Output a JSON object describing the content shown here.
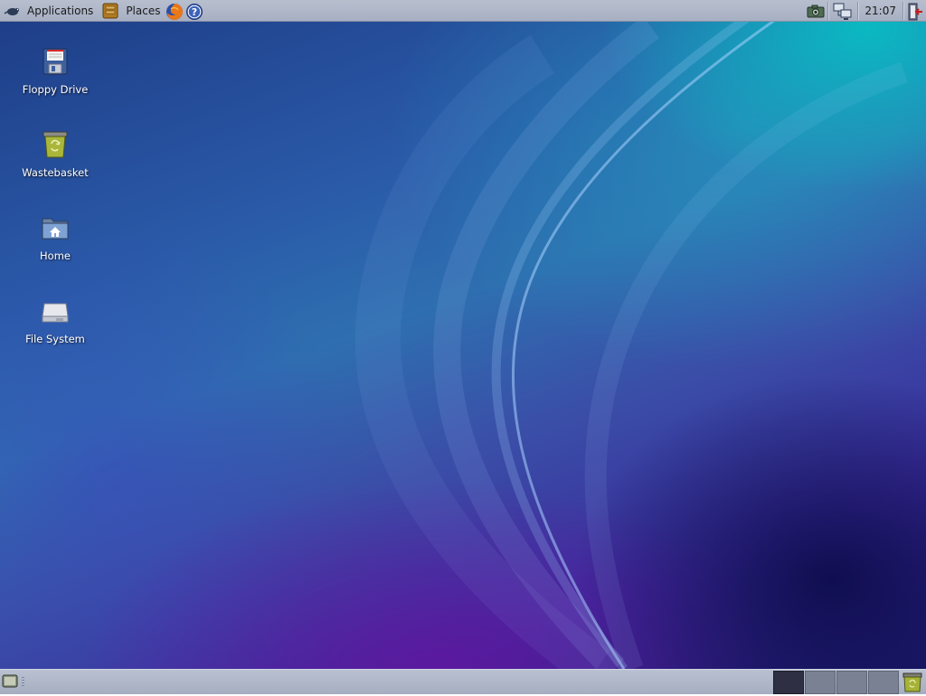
{
  "top_panel": {
    "applications_label": "Applications",
    "places_label": "Places",
    "clock": "21:07"
  },
  "desktop_icons": [
    {
      "label": "Floppy Drive",
      "icon": "floppy-drive-icon"
    },
    {
      "label": "Wastebasket",
      "icon": "wastebasket-icon"
    },
    {
      "label": "Home",
      "icon": "home-folder-icon"
    },
    {
      "label": "File System",
      "icon": "file-system-icon"
    }
  ],
  "bottom_panel": {
    "workspaces": [
      {
        "active": true
      },
      {
        "active": false
      },
      {
        "active": false
      },
      {
        "active": false
      }
    ]
  },
  "colors": {
    "panel_bg": "#aeb6c8",
    "active_workspace": "#2e2f42",
    "inactive_workspace": "#7a8193"
  }
}
